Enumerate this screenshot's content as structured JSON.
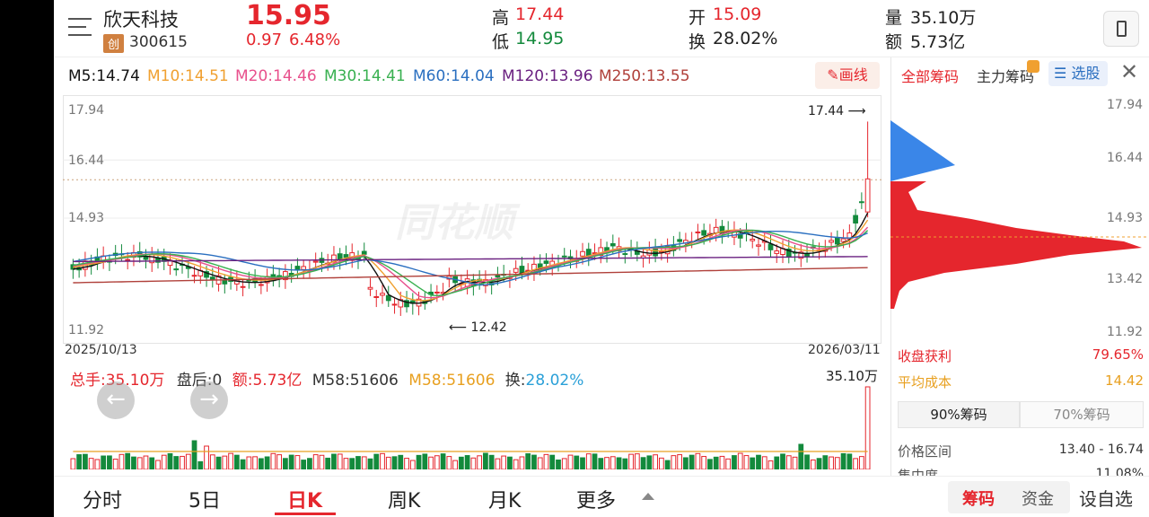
{
  "stock": {
    "name": "欣天科技",
    "board": "创",
    "code": "300615",
    "price": "15.95",
    "change": "0.97",
    "pct": "6.48%"
  },
  "quote": {
    "high_label": "高",
    "high": "17.44",
    "low_label": "低",
    "low": "14.95",
    "open_label": "开",
    "open": "15.09",
    "turn_label": "换",
    "turn": "28.02%",
    "vol_label": "量",
    "vol": "35.10万",
    "amt_label": "额",
    "amt": "5.73亿"
  },
  "ma": [
    {
      "label": "M5:14.74",
      "color": "#111111"
    },
    {
      "label": "M10:14.51",
      "color": "#f0a030"
    },
    {
      "label": "M20:14.46",
      "color": "#e8508c"
    },
    {
      "label": "M30:14.41",
      "color": "#38b050"
    },
    {
      "label": "M60:14.04",
      "color": "#2a6fc0"
    },
    {
      "label": "M120:13.96",
      "color": "#6a2080"
    },
    {
      "label": "M250:13.55",
      "color": "#b0403a"
    }
  ],
  "draw_line": "画线",
  "price_axis": [
    "17.94",
    "16.44",
    "14.93",
    "11.92"
  ],
  "date_start": "2025/10/13",
  "date_end": "2026/03/11",
  "high_marker": "17.44",
  "low_marker": "12.42",
  "watermark": "同花顺",
  "vol_bar": {
    "total": "总手:35.10万",
    "after": "盘后:0",
    "amount": "额:5.73亿",
    "m58a": "M58:51606",
    "m58b": "M58:51606",
    "turn_label": "换:",
    "turn": "28.02%",
    "max": "35.10万"
  },
  "chip_tabs": [
    "全部筹码",
    "主力筹码",
    "选股"
  ],
  "chip_axis": [
    "17.94",
    "16.44",
    "14.93",
    "13.42",
    "11.92"
  ],
  "chip_stats": {
    "profit_label": "收盘获利",
    "profit": "79.65%",
    "avg_label": "平均成本",
    "avg": "14.42",
    "tab90": "90%筹码",
    "tab70": "70%筹码",
    "range_label": "价格区间",
    "range": "13.40 - 16.74",
    "conc_label": "集中度",
    "conc": "11.08%"
  },
  "bottom_tabs": [
    "分时",
    "5日",
    "日K",
    "周K",
    "月K",
    "更多"
  ],
  "right_tabs": [
    "筹码",
    "资金",
    "设自选"
  ],
  "chart_data": {
    "type": "candlestick",
    "title": "",
    "x_range": [
      "2025/10/13",
      "2026/03/11"
    ],
    "ylim": [
      11.92,
      17.94
    ],
    "high": 17.44,
    "low": 12.42,
    "last_close": 15.95,
    "ma": {
      "M5": 14.74,
      "M10": 14.51,
      "M20": 14.46,
      "M30": 14.41,
      "M60": 14.04,
      "M120": 13.96,
      "M250": 13.55
    },
    "volume_max": "35.10万"
  }
}
